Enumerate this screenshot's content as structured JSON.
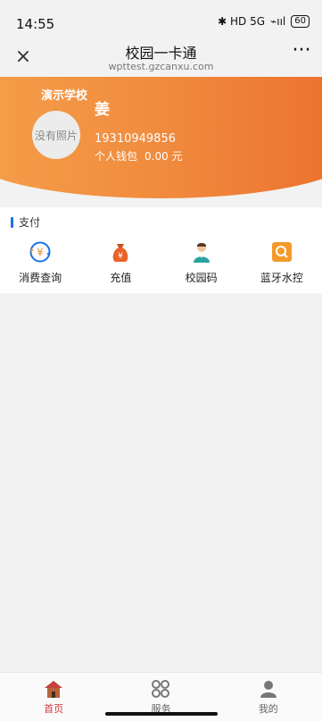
{
  "status": {
    "time": "14:55",
    "icons_text": "✱ HD 5G",
    "signal_text": "⌁ııl",
    "battery": "60"
  },
  "nav": {
    "close_label": "×",
    "title": "校园一卡通",
    "subtitle": "wpttest.gzcanxu.com",
    "more_label": "···"
  },
  "hero": {
    "school": "演示学校",
    "avatar_text": "没有照片",
    "name": "姜",
    "phone": "19310949856",
    "wallet_label": "个人钱包",
    "wallet_amount": "0.00 元"
  },
  "section": {
    "title": "支付",
    "items": [
      {
        "label": "消费查询",
        "icon": "consumption-query-icon"
      },
      {
        "label": "充值",
        "icon": "recharge-moneybag-icon"
      },
      {
        "label": "校园码",
        "icon": "campus-code-person-icon"
      },
      {
        "label": "蓝牙水控",
        "icon": "bluetooth-water-control-icon"
      }
    ]
  },
  "tabbar": {
    "tabs": [
      {
        "label": "首页",
        "icon": "home-icon"
      },
      {
        "label": "服务",
        "icon": "service-icon"
      },
      {
        "label": "我的",
        "icon": "user-icon"
      }
    ]
  },
  "colors": {
    "hero_gradient_start": "#f5a04a",
    "hero_gradient_end": "#ec6f2d",
    "accent_blue": "#1a73e8",
    "active_tab": "#d9363e"
  }
}
